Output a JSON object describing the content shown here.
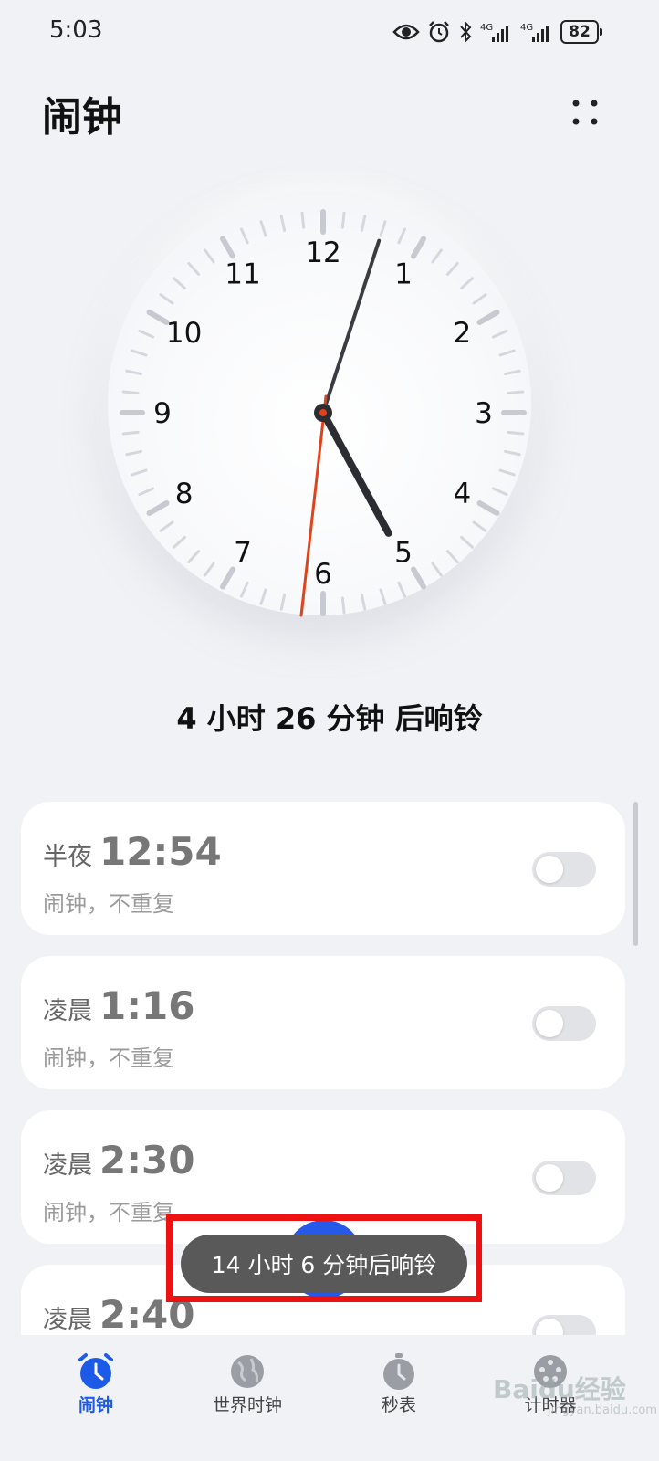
{
  "status_bar": {
    "time": "5:03",
    "battery": "82",
    "network_1": "4G",
    "network_2": "4G"
  },
  "header": {
    "title": "闹钟",
    "more_icon": "more-dots-icon"
  },
  "clock": {
    "numbers": [
      "12",
      "1",
      "2",
      "3",
      "4",
      "5",
      "6",
      "7",
      "8",
      "9",
      "10",
      "11"
    ],
    "hour_hand_time": "5:03",
    "second_hand_color": "#e0421c"
  },
  "countdown_text": "4 小时 26 分钟 后响铃",
  "alarms": [
    {
      "period": "半夜",
      "time": "12:54",
      "sub": "闹钟，不重复",
      "enabled": false
    },
    {
      "period": "凌晨",
      "time": "1:16",
      "sub": "闹钟，不重复",
      "enabled": false
    },
    {
      "period": "凌晨",
      "time": "2:30",
      "sub": "闹钟，不重复",
      "enabled": false
    },
    {
      "period": "凌晨",
      "time": "2:40",
      "sub": "",
      "enabled": false
    }
  ],
  "toast": "14 小时 6 分钟后响铃",
  "tabs": [
    {
      "label": "闹钟",
      "icon": "alarm-clock-icon",
      "active": true
    },
    {
      "label": "世界时钟",
      "icon": "globe-icon",
      "active": false
    },
    {
      "label": "秒表",
      "icon": "stopwatch-icon",
      "active": false
    },
    {
      "label": "计时器",
      "icon": "timer-icon",
      "active": false
    }
  ],
  "watermark": "Baidu经验",
  "watermark_url": "jingyan.baidu.com",
  "colors": {
    "accent": "#1e5ae8",
    "highlight": "#ee1111",
    "toast_bg": "#595959"
  }
}
